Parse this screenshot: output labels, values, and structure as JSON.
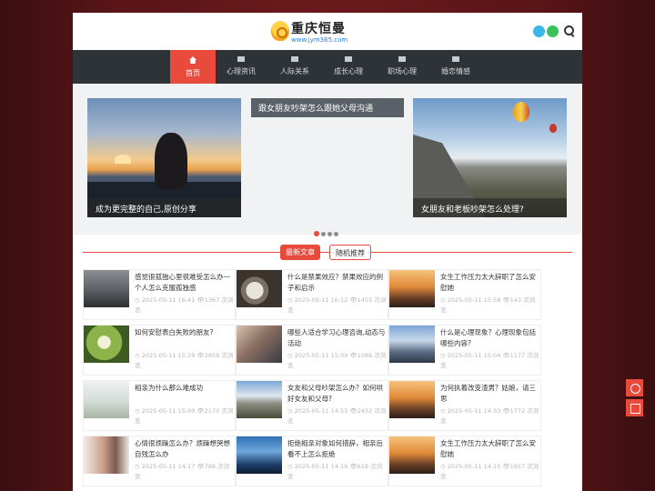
{
  "site": {
    "title": "重庆恒曼",
    "url": "www.jym365.com"
  },
  "nav": [
    {
      "label": "首页",
      "active": true
    },
    {
      "label": "心理资讯"
    },
    {
      "label": "人际关系"
    },
    {
      "label": "成长心理"
    },
    {
      "label": "职场心理"
    },
    {
      "label": "婚恋情感"
    }
  ],
  "slider": {
    "left_caption": "成为更完整的自己,原创分享",
    "middle_title": "跟女朋友吵架怎么跟她父母沟通",
    "right_caption": "女朋友和老板吵架怎么处理?"
  },
  "tabs": {
    "latest": "最新文章",
    "random": "随机推荐"
  },
  "articles": [
    {
      "title": "感觉很孤独心里很难受怎么办一个人怎么克服孤独感",
      "date": "2025-05-11 16:41",
      "views": "1367 次浏览"
    },
    {
      "title": "什么是禁果效应？禁果效应的例子和启示",
      "date": "2025-05-11 16:12",
      "views": "1455 次浏览"
    },
    {
      "title": "女生工作压力太大辞职了怎么安慰她",
      "date": "2025-05-11 15:58",
      "views": "143 次浏览"
    },
    {
      "title": "如何安慰表白失败的朋友?",
      "date": "2025-05-11 15:29",
      "views": "2859 次浏览"
    },
    {
      "title": "哪些人适合学习心理咨询,动态与活动",
      "date": "2025-05-11 15:09",
      "views": "1086 次浏览"
    },
    {
      "title": "什么是心理现象？心理现象包括哪些内容?",
      "date": "2025-05-11 15:04",
      "views": "1177 次浏览"
    },
    {
      "title": "相亲为什么那么难成功",
      "date": "2025-05-11 15:00",
      "views": "2170 次浏览"
    },
    {
      "title": "女友和父母吵架怎么办？如何哄好女友和父母?",
      "date": "2025-05-11 14:55",
      "views": "2452 次浏览"
    },
    {
      "title": "为何执着改变渣男？姑娘，请三思",
      "date": "2025-05-11 14:33",
      "views": "1772 次浏览"
    },
    {
      "title": "心情很烦躁怎么办？烦躁想哭想自残怎么办",
      "date": "2025-05-11 14:17",
      "views": "788 次浏览"
    },
    {
      "title": "拒绝相亲对象如何措辞，相亲后看不上怎么拒绝",
      "date": "2025-05-11 14:16",
      "views": "619 次浏览"
    },
    {
      "title": "女生工作压力太大辞职了怎么安慰她",
      "date": "2025-05-11 14:15",
      "views": "1657 次浏览"
    }
  ]
}
